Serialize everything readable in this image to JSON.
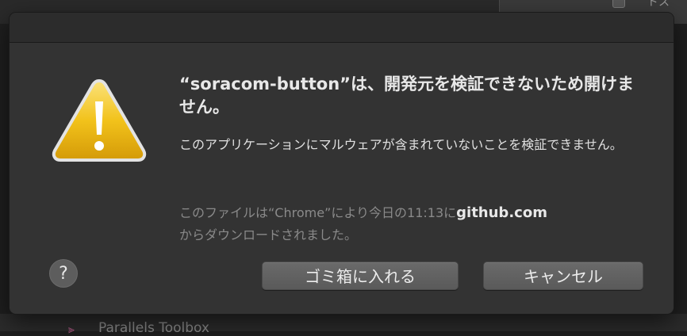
{
  "background": {
    "topright_text": "ドス",
    "bottom_text": "Parallels Toolbox"
  },
  "dialog": {
    "heading": "“soracom-button”は、開発元を検証できないため開けません。",
    "message": "このアプリケーションにマルウェアが含まれていないことを検証できません。",
    "source_prefix": "このファイルは“Chrome”により今日の11:13に",
    "source_site": "github.com",
    "source_suffix": "からダウンロードされました。",
    "help_label": "?",
    "buttons": {
      "trash": "ゴミ箱に入れる",
      "cancel": "キャンセル"
    },
    "icon": "warning-icon"
  },
  "colors": {
    "dialog_bg": "#333333",
    "warning_yellow": "#f2c21b",
    "button_bg": "#636363"
  }
}
